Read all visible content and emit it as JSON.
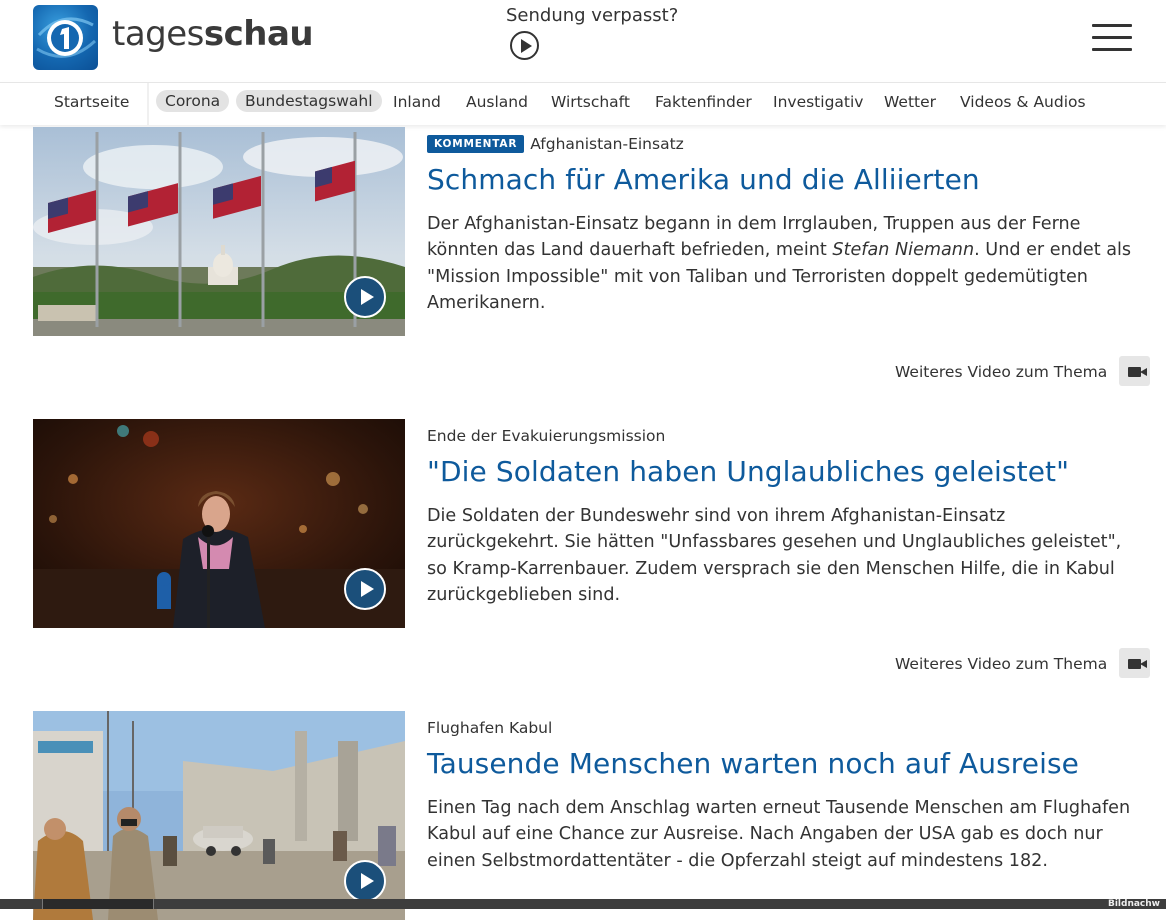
{
  "header": {
    "brand_light": "tages",
    "brand_bold": "schau",
    "missed_label": "Sendung verpasst?"
  },
  "nav": {
    "items": [
      {
        "label": "Startseite"
      },
      {
        "label": "Corona",
        "pill": true
      },
      {
        "label": "Bundestagswahl",
        "pill": true
      },
      {
        "label": "Inland"
      },
      {
        "label": "Ausland"
      },
      {
        "label": "Wirtschaft"
      },
      {
        "label": "Faktenfinder"
      },
      {
        "label": "Investigativ"
      },
      {
        "label": "Wetter"
      },
      {
        "label": "Videos & Audios"
      }
    ]
  },
  "articles": [
    {
      "badge": "KOMMENTAR",
      "kicker": "Afghanistan-Einsatz",
      "headline": "Schmach für Amerika und die Alliierten",
      "teaser_before": "Der Afghanistan-Einsatz begann in dem Irrglauben, Truppen aus der Ferne könnten das Land dauerhaft befrieden, meint ",
      "teaser_italic": "Stefan Niemann",
      "teaser_after": ". Und er endet als \"Mission Impossible\" mit von Taliban und Terroristen doppelt gedemütigten Amerikanern.",
      "more_label": "Weiteres Video zum Thema"
    },
    {
      "kicker": "Ende der Evakuierungsmission",
      "headline": "\"Die Soldaten haben Unglaubliches geleistet\"",
      "teaser": "Die Soldaten der Bundeswehr sind von ihrem Afghanistan-Einsatz zurückgekehrt. Sie hätten \"Unfassbares gesehen und Unglaubliches geleistet\", so Kramp-Karrenbauer. Zudem versprach sie den Menschen Hilfe, die in Kabul zurückgeblieben sind.",
      "more_label": "Weiteres Video zum Thema"
    },
    {
      "kicker": "Flughafen Kabul",
      "headline": "Tausende Menschen warten noch auf Ausreise",
      "teaser": "Einen Tag nach dem Anschlag warten erneut Tausende Menschen am Flughafen Kabul auf eine Chance zur Ausreise. Nach Angaben der USA gab es doch nur einen Selbstmordattentäter - die Opferzahl steigt auf mindestens 182."
    }
  ],
  "footer": {
    "bildnachweis": "Bildnachw"
  }
}
